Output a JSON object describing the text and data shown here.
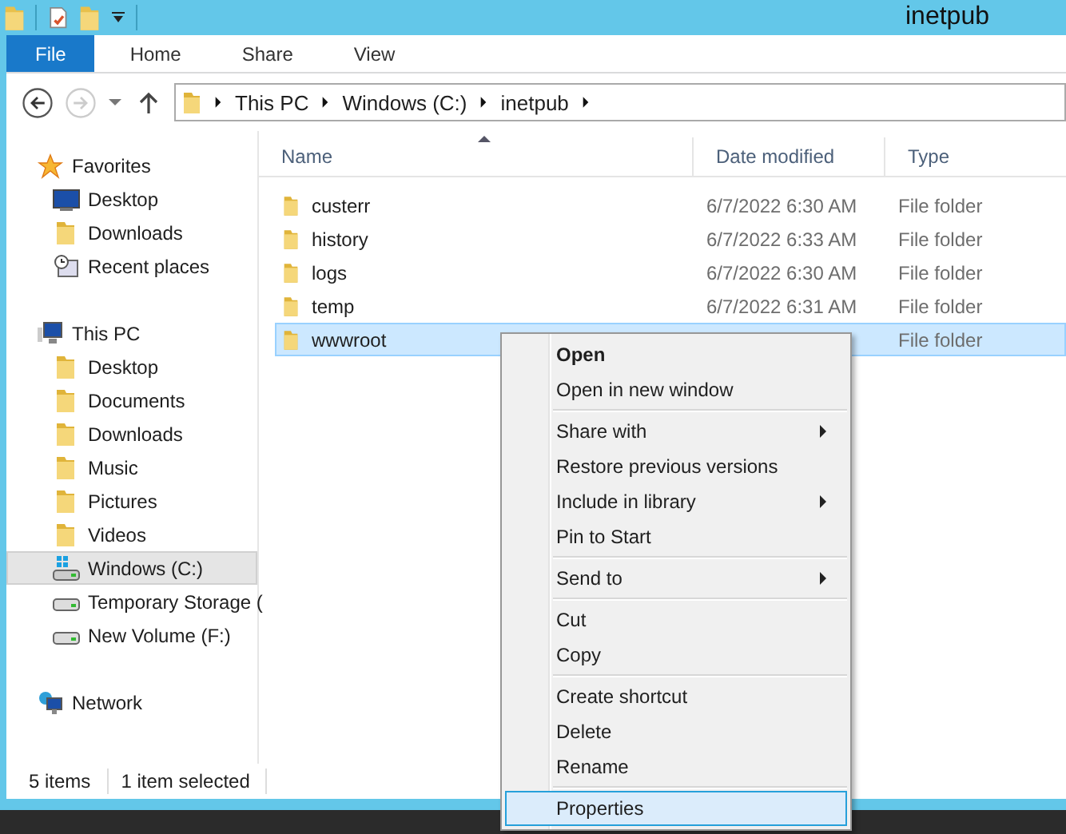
{
  "window": {
    "title": "inetpub"
  },
  "ribbon_tabs": [
    {
      "label": "File",
      "selected": true
    },
    {
      "label": "Home",
      "selected": false
    },
    {
      "label": "Share",
      "selected": false
    },
    {
      "label": "View",
      "selected": false
    }
  ],
  "address": {
    "crumbs": [
      "This PC",
      "Windows (C:)",
      "inetpub"
    ]
  },
  "sidebar": {
    "groups": [
      {
        "label": "Favorites",
        "kind": "star",
        "selected": false,
        "children": [
          {
            "label": "Desktop",
            "kind": "monitor",
            "selected": false
          },
          {
            "label": "Downloads",
            "kind": "folder",
            "selected": false
          },
          {
            "label": "Recent places",
            "kind": "recent",
            "selected": false
          }
        ]
      },
      {
        "label": "This PC",
        "kind": "pc",
        "selected": false,
        "children": [
          {
            "label": "Desktop",
            "kind": "folder",
            "selected": false
          },
          {
            "label": "Documents",
            "kind": "folder",
            "selected": false
          },
          {
            "label": "Downloads",
            "kind": "folder",
            "selected": false
          },
          {
            "label": "Music",
            "kind": "folder",
            "selected": false
          },
          {
            "label": "Pictures",
            "kind": "folder",
            "selected": false
          },
          {
            "label": "Videos",
            "kind": "folder",
            "selected": false
          },
          {
            "label": "Windows (C:)",
            "kind": "windrive",
            "selected": true
          },
          {
            "label": "Temporary Storage (",
            "kind": "drive",
            "selected": false
          },
          {
            "label": "New Volume (F:)",
            "kind": "drive",
            "selected": false
          }
        ]
      },
      {
        "label": "Network",
        "kind": "network",
        "selected": false
      }
    ]
  },
  "files": {
    "columns": [
      "Name",
      "Date modified",
      "Type"
    ],
    "rows": [
      {
        "name": "custerr",
        "date": "6/7/2022 6:30 AM",
        "type": "File folder",
        "selected": false
      },
      {
        "name": "history",
        "date": "6/7/2022 6:33 AM",
        "type": "File folder",
        "selected": false
      },
      {
        "name": "logs",
        "date": "6/7/2022 6:30 AM",
        "type": "File folder",
        "selected": false
      },
      {
        "name": "temp",
        "date": "6/7/2022 6:31 AM",
        "type": "File folder",
        "selected": false
      },
      {
        "name": "wwwroot",
        "type": "File folder",
        "selected": true
      }
    ]
  },
  "status_bar": [
    "5 items",
    "1 item selected"
  ],
  "context_menu": [
    {
      "kind": "item",
      "label": "Open",
      "default": true,
      "submenu": false,
      "selected": false
    },
    {
      "kind": "item",
      "label": "Open in new window",
      "default": false,
      "submenu": false,
      "selected": false
    },
    {
      "kind": "separator"
    },
    {
      "kind": "item",
      "label": "Share with",
      "default": false,
      "submenu": true,
      "selected": false
    },
    {
      "kind": "item",
      "label": "Restore previous versions",
      "default": false,
      "submenu": false,
      "selected": false
    },
    {
      "kind": "item",
      "label": "Include in library",
      "default": false,
      "submenu": true,
      "selected": false
    },
    {
      "kind": "item",
      "label": "Pin to Start",
      "default": false,
      "submenu": false,
      "selected": false
    },
    {
      "kind": "separator"
    },
    {
      "kind": "item",
      "label": "Send to",
      "default": false,
      "submenu": true,
      "selected": false
    },
    {
      "kind": "separator"
    },
    {
      "kind": "item",
      "label": "Cut",
      "default": false,
      "submenu": false,
      "selected": false
    },
    {
      "kind": "item",
      "label": "Copy",
      "default": false,
      "submenu": false,
      "selected": false
    },
    {
      "kind": "separator"
    },
    {
      "kind": "item",
      "label": "Create shortcut",
      "default": false,
      "submenu": false,
      "selected": false
    },
    {
      "kind": "item",
      "label": "Delete",
      "default": false,
      "submenu": false,
      "selected": false
    },
    {
      "kind": "item",
      "label": "Rename",
      "default": false,
      "submenu": false,
      "selected": false
    },
    {
      "kind": "separator"
    },
    {
      "kind": "item",
      "label": "Properties",
      "default": false,
      "submenu": false,
      "selected": true
    }
  ]
}
